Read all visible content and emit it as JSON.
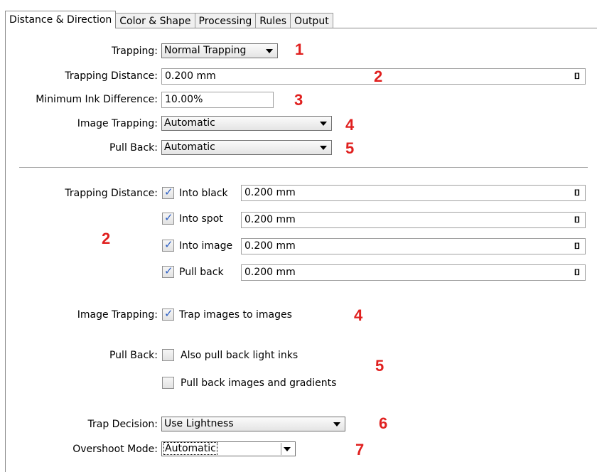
{
  "tabs": [
    {
      "label": "Distance & Direction"
    },
    {
      "label": "Color & Shape"
    },
    {
      "label": "Processing"
    },
    {
      "label": "Rules"
    },
    {
      "label": "Output"
    }
  ],
  "top": {
    "trapping_label": "Trapping:",
    "trapping_value": "Normal Trapping",
    "distance_label": "Trapping Distance:",
    "distance_value": "0.200 mm",
    "min_ink_label": "Minimum Ink Difference:",
    "min_ink_value": "10.00%",
    "image_trapping_label": "Image Trapping:",
    "image_trapping_value": "Automatic",
    "pull_back_label": "Pull Back:",
    "pull_back_value": "Automatic"
  },
  "distances": {
    "label": "Trapping Distance:",
    "rows": [
      {
        "label": "Into black",
        "value": "0.200 mm",
        "checked": true
      },
      {
        "label": "Into spot",
        "value": "0.200 mm",
        "checked": true
      },
      {
        "label": "Into image",
        "value": "0.200 mm",
        "checked": true
      },
      {
        "label": "Pull back",
        "value": "0.200 mm",
        "checked": true
      }
    ]
  },
  "image_trapping": {
    "label": "Image Trapping:",
    "option": "Trap images to images",
    "checked": true
  },
  "pull_back": {
    "label": "Pull Back:",
    "options": [
      {
        "label": "Also pull back light inks",
        "checked": false
      },
      {
        "label": "Pull back images and gradients",
        "checked": false
      }
    ]
  },
  "trap_decision": {
    "label": "Trap Decision:",
    "value": "Use Lightness"
  },
  "overshoot": {
    "label": "Overshoot Mode:",
    "value": "Automatic"
  },
  "annotations": {
    "n1": "1",
    "n2a": "2",
    "n3": "3",
    "n4a": "4",
    "n5a": "5",
    "n2b": "2",
    "n4b": "4",
    "n5b": "5",
    "n6": "6",
    "n7": "7"
  },
  "icons": {
    "link": "[]"
  },
  "colors": {
    "annotation": "#e0201f",
    "check": "#2d5fc3"
  }
}
